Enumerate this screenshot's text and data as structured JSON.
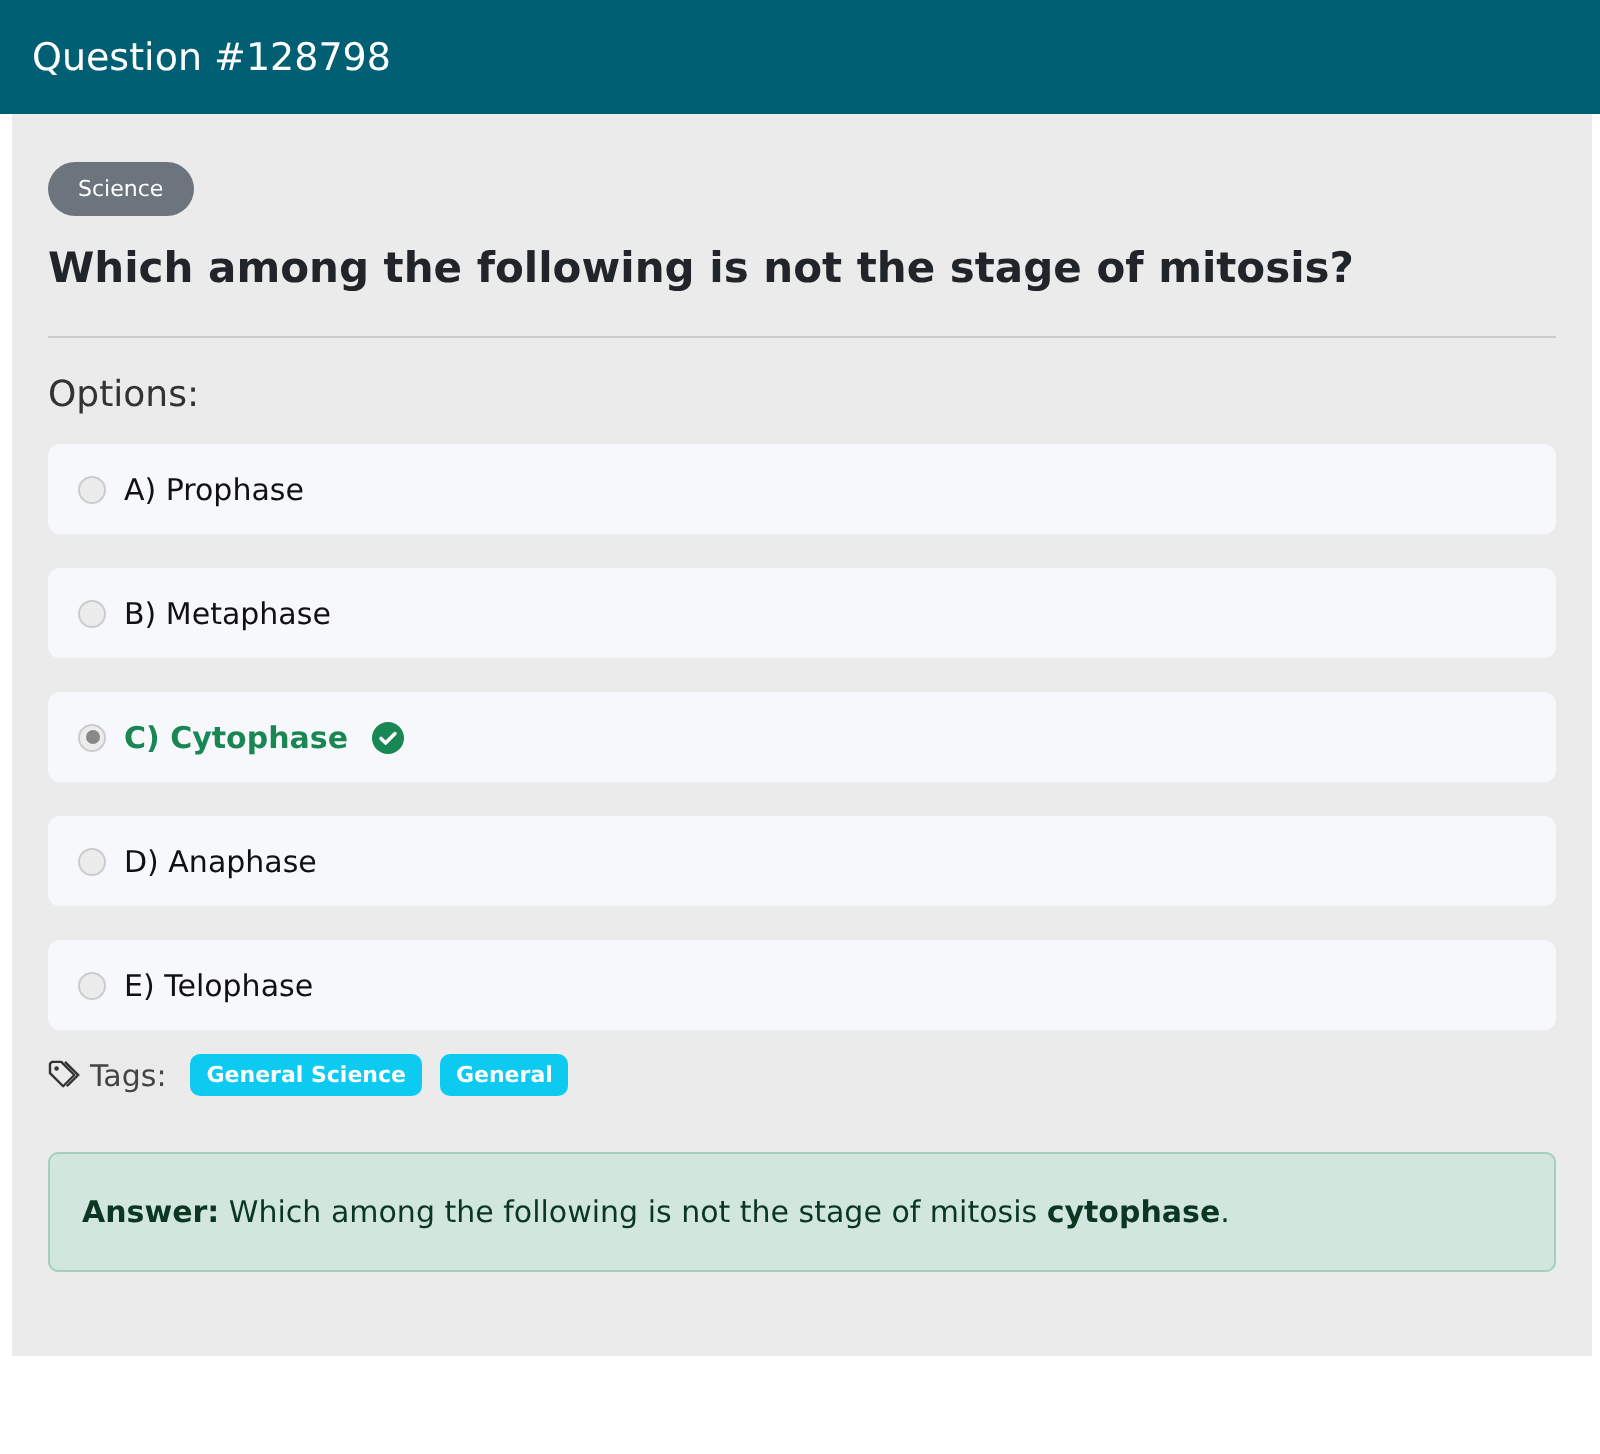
{
  "header": {
    "title": "Question #128798"
  },
  "category": "Science",
  "question": "Which among the following is not the stage of mitosis?",
  "options_label": "Options:",
  "options": [
    {
      "label": "A) Prophase",
      "selected": false,
      "correct": false
    },
    {
      "label": "B) Metaphase",
      "selected": false,
      "correct": false
    },
    {
      "label": "C) Cytophase",
      "selected": true,
      "correct": true
    },
    {
      "label": "D) Anaphase",
      "selected": false,
      "correct": false
    },
    {
      "label": "E) Telophase",
      "selected": false,
      "correct": false
    }
  ],
  "tags_label": "Tags:",
  "tags": [
    "General Science",
    "General"
  ],
  "answer": "**Answer:** Which among the following is not the stage of mitosis **cytophase**."
}
